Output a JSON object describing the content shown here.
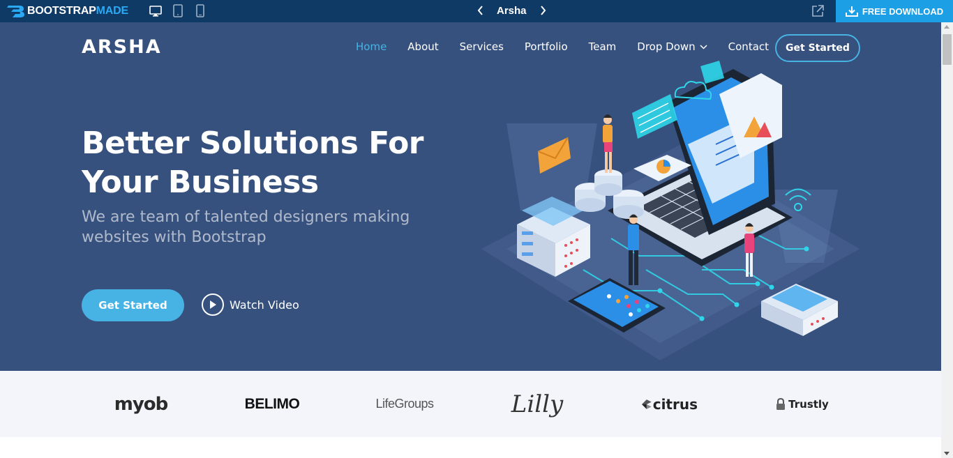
{
  "topbar": {
    "brand_bold": "BOOTSTRAP",
    "brand_accent": "MADE",
    "template_name": "Arsha",
    "download_label": "FREE DOWNLOAD"
  },
  "header": {
    "logo": "ARSHA",
    "nav": [
      {
        "label": "Home",
        "active": true
      },
      {
        "label": "About"
      },
      {
        "label": "Services"
      },
      {
        "label": "Portfolio"
      },
      {
        "label": "Team"
      },
      {
        "label": "Drop Down",
        "has_dropdown": true
      },
      {
        "label": "Contact"
      }
    ],
    "cta": "Get Started"
  },
  "hero": {
    "title_line1": "Better Solutions For",
    "title_line2": "Your Business",
    "subtitle": "We are team of talented designers making websites with Bootstrap",
    "primary_button": "Get Started",
    "video_button": "Watch Video"
  },
  "clients": {
    "logos": [
      "myob",
      "BELIMO",
      "LifeGroups",
      "Lilly",
      "citrus",
      "Trustly"
    ]
  },
  "colors": {
    "topbar_bg": "#0f3a66",
    "download_bg": "#1d9fe6",
    "hero_bg": "#37517e",
    "accent": "#47b2e4",
    "clients_bg": "#f3f5fa"
  },
  "icons": [
    "desktop-icon",
    "tablet-icon",
    "mobile-icon",
    "chevron-left-icon",
    "chevron-right-icon",
    "external-link-icon",
    "download-icon",
    "chevron-down-icon",
    "play-icon"
  ]
}
